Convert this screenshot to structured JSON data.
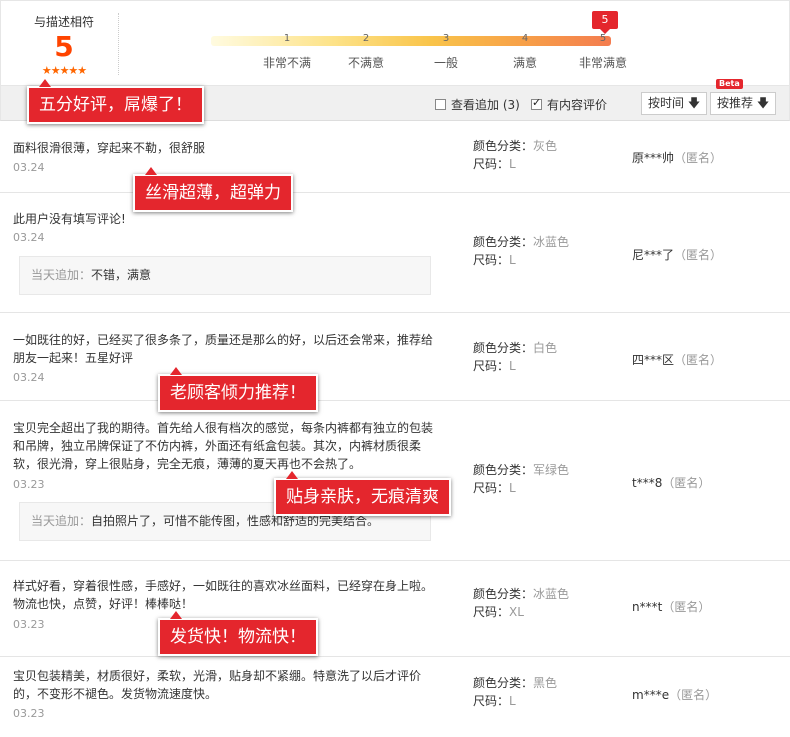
{
  "summary": {
    "title": "与描述相符",
    "score": "5",
    "stars": "★★★★★",
    "scale_numbers": [
      "1",
      "2",
      "3",
      "4",
      "5"
    ],
    "scale_labels": [
      "非常不满",
      "不满意",
      "一般",
      "满意",
      "非常满意"
    ],
    "marker": "5"
  },
  "toolbar": {
    "filter_append": "查看追加 (3)",
    "filter_content": "有内容评价",
    "sort_time": "按时间 🡇",
    "sort_recommend": "按推荐 🡇",
    "beta": "Beta"
  },
  "reviews": [
    {
      "text": "面料很滑很薄，穿起来不勒，很舒服",
      "date": "03.24",
      "attr_color_key": "颜色分类：",
      "attr_color_val": "灰色",
      "attr_size_key": "尺码：",
      "attr_size_val": "L",
      "user": "原***帅",
      "anon": "（匿名）"
    },
    {
      "text": "此用户没有填写评论!",
      "date": "03.24",
      "append_label": "当天追加：",
      "append_text": "不错，满意",
      "attr_color_key": "颜色分类：",
      "attr_color_val": "冰蓝色",
      "attr_size_key": "尺码：",
      "attr_size_val": "L",
      "user": "尼***了",
      "anon": "（匿名）"
    },
    {
      "text": "一如既往的好，已经买了很多条了，质量还是那么的好，以后还会常来，推荐给朋友一起来！五星好评",
      "date": "03.24",
      "attr_color_key": "颜色分类：",
      "attr_color_val": "白色",
      "attr_size_key": "尺码：",
      "attr_size_val": "L",
      "user": "四***区",
      "anon": "（匿名）"
    },
    {
      "text": "宝贝完全超出了我的期待。首先给人很有档次的感觉，每条内裤都有独立的包装和吊牌，独立吊牌保证了不仿内裤，外面还有纸盒包装。其次，内裤材质很柔软，很光滑，穿上很贴身，完全无痕，薄薄的夏天再也不会热了。",
      "date": "03.23",
      "append_label": "当天追加：",
      "append_text": "自拍照片了，可惜不能传图，性感和舒适的完美结合。",
      "attr_color_key": "颜色分类：",
      "attr_color_val": "军绿色",
      "attr_size_key": "尺码：",
      "attr_size_val": "L",
      "user": "t***8",
      "anon": "（匿名）"
    },
    {
      "text": "样式好看，穿着很性感，手感好，一如既往的喜欢冰丝面料，已经穿在身上啦。物流也快，点赞，好评！棒棒哒！",
      "date": "03.23",
      "attr_color_key": "颜色分类：",
      "attr_color_val": "冰蓝色",
      "attr_size_key": "尺码：",
      "attr_size_val": "XL",
      "user": "n***t",
      "anon": "（匿名）"
    },
    {
      "text": "宝贝包装精美，材质很好，柔软，光滑，贴身却不紧绷。特意洗了以后才评价的，不变形不褪色。发货物流速度快。",
      "date": "03.23",
      "attr_color_key": "颜色分类：",
      "attr_color_val": "黑色",
      "attr_size_key": "尺码：",
      "attr_size_val": "L",
      "user": "m***e",
      "anon": "（匿名）"
    }
  ],
  "callouts": [
    "五分好评，屌爆了！",
    "丝滑超薄，超弹力",
    "老顾客倾力推荐！",
    "贴身亲肤，无痕清爽",
    "发货快！物流快！"
  ],
  "colors": {
    "accent": "#e4262d",
    "score": "#ff4400",
    "star": "#ff6600"
  }
}
